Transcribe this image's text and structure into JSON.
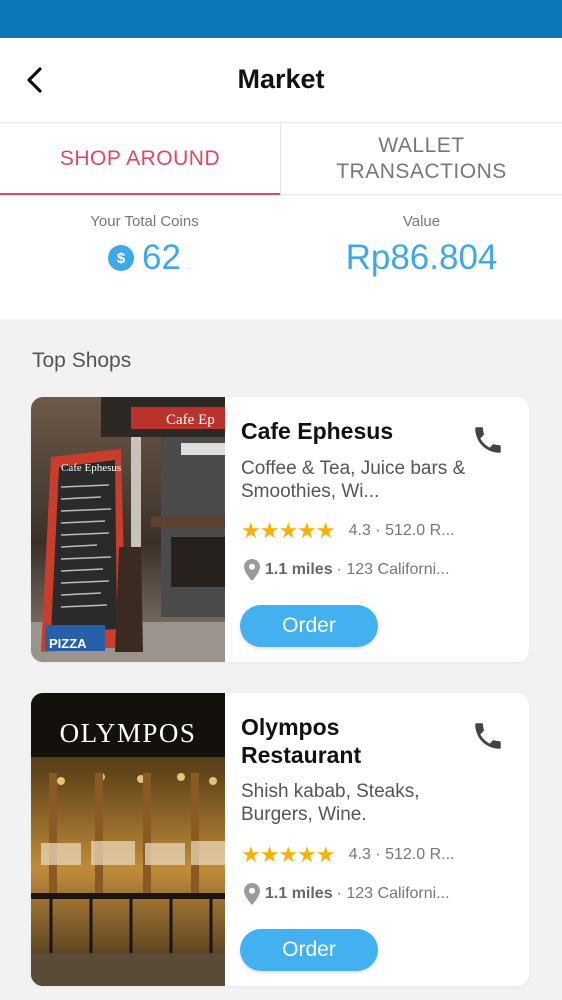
{
  "header": {
    "title": "Market"
  },
  "tabs": [
    {
      "label": "SHOP AROUND",
      "active": true
    },
    {
      "label": "WALLET TRANSACTIONS",
      "active": false
    }
  ],
  "coins": {
    "total_label": "Your Total Coins",
    "total_value": "62",
    "currency_symbol": "$",
    "value_label": "Value",
    "value": "Rp86.804"
  },
  "section": {
    "title": "Top Shops"
  },
  "shops": [
    {
      "name": "Cafe Ephesus",
      "categories": "Coffee & Tea, Juice bars & Smoothies, Wi...",
      "stars": "★★★★★",
      "rating": "4.3 · 512.0 R...",
      "distance": "1.1 miles",
      "address": "· 123 Californi...",
      "order_label": "Order",
      "image_sign": "Cafe Ep",
      "image_board_title": "Cafe Ephesus",
      "image_pizza": "PIZZA"
    },
    {
      "name": "Olympos Restaurant",
      "categories": "Shish kabab, Steaks, Burgers, Wine.",
      "stars": "★★★★★",
      "rating": "4.3 · 512.0 R...",
      "distance": "1.1 miles",
      "address": "· 123 Californi...",
      "order_label": "Order",
      "image_sign": "OLYMPOS"
    }
  ],
  "colors": {
    "status_bar": "#0a77b8",
    "accent_pink": "#e04661",
    "accent_blue": "#3fa8e8",
    "star": "#f5b20a"
  },
  "icons": [
    "back-arrow-icon",
    "coin-icon",
    "phone-icon",
    "location-pin-icon",
    "star-icon"
  ]
}
